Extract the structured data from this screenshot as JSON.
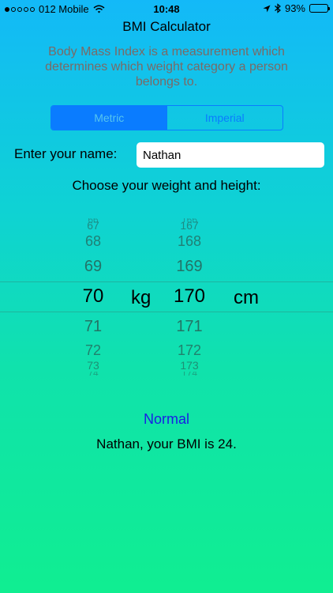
{
  "status_bar": {
    "carrier": "012 Mobile",
    "time": "10:48",
    "battery": "93%",
    "battery_level": 0.93
  },
  "header": {
    "title": "BMI Calculator",
    "description": "Body Mass Index is a measurement which determines which weight category a person belongs to."
  },
  "units_segment": {
    "options": [
      "Metric",
      "Imperial"
    ],
    "selected": "Metric"
  },
  "name_field": {
    "label": "Enter your name:",
    "value": "Nathan"
  },
  "picker_prompt": "Choose your weight and height:",
  "weight_picker": {
    "unit": "kg",
    "values": [
      "66",
      "67",
      "68",
      "69",
      "70",
      "71",
      "72",
      "73",
      "74"
    ],
    "selected": "70"
  },
  "height_picker": {
    "unit": "cm",
    "values": [
      "166",
      "167",
      "168",
      "169",
      "170",
      "171",
      "172",
      "173",
      "174"
    ],
    "selected": "170"
  },
  "result": {
    "category": "Normal",
    "message": "Nathan, your BMI is 24."
  },
  "colors": {
    "accent": "#0a7cff",
    "category_text": "#1a1de6",
    "description_text": "#7a6a66",
    "gradient_top": "#13b9f8",
    "gradient_bottom": "#10ee91"
  }
}
